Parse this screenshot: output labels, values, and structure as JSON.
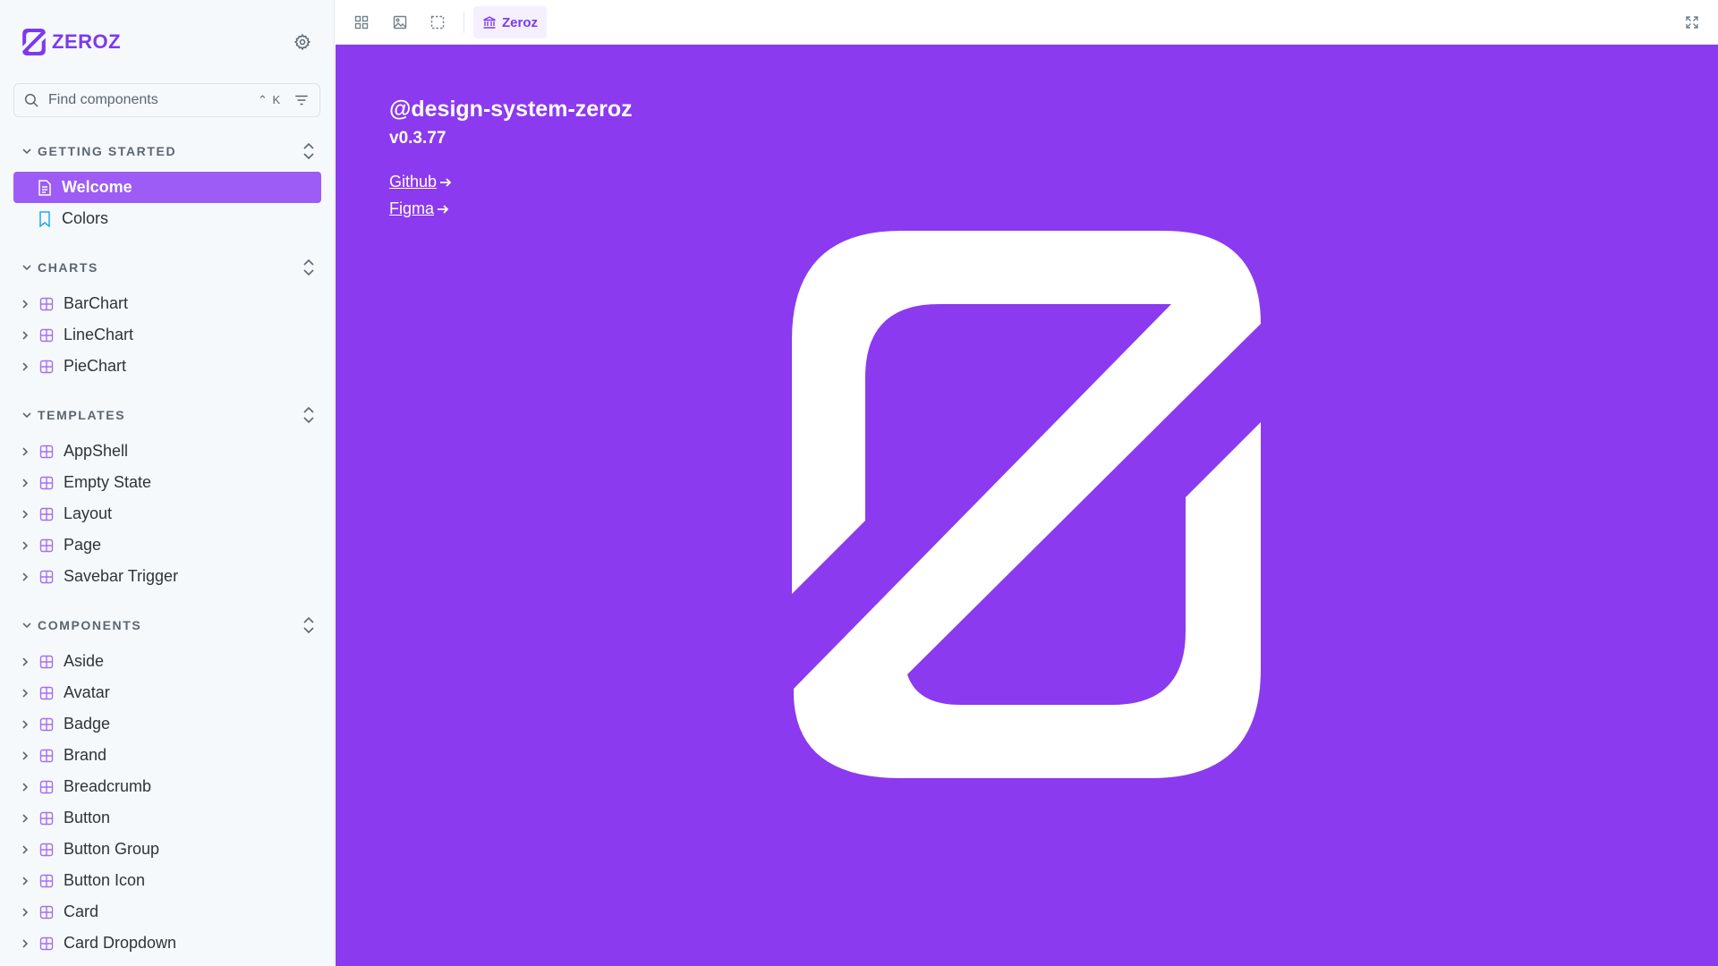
{
  "brand": {
    "name": "ZEROZ",
    "accent": "#7c3aed"
  },
  "search": {
    "placeholder": "Find components",
    "shortcut": "⌃ K"
  },
  "sections": [
    {
      "label": "GETTING STARTED",
      "items": [
        {
          "label": "Welcome",
          "icon": "document-icon",
          "active": true
        },
        {
          "label": "Colors",
          "icon": "bookmark-icon"
        }
      ]
    },
    {
      "label": "CHARTS",
      "items": [
        {
          "label": "BarChart",
          "icon": "component-icon"
        },
        {
          "label": "LineChart",
          "icon": "component-icon"
        },
        {
          "label": "PieChart",
          "icon": "component-icon"
        }
      ]
    },
    {
      "label": "TEMPLATES",
      "items": [
        {
          "label": "AppShell",
          "icon": "component-icon"
        },
        {
          "label": "Empty State",
          "icon": "component-icon"
        },
        {
          "label": "Layout",
          "icon": "component-icon"
        },
        {
          "label": "Page",
          "icon": "component-icon"
        },
        {
          "label": "Savebar Trigger",
          "icon": "component-icon"
        }
      ]
    },
    {
      "label": "COMPONENTS",
      "items": [
        {
          "label": "Aside",
          "icon": "component-icon"
        },
        {
          "label": "Avatar",
          "icon": "component-icon"
        },
        {
          "label": "Badge",
          "icon": "component-icon"
        },
        {
          "label": "Brand",
          "icon": "component-icon"
        },
        {
          "label": "Breadcrumb",
          "icon": "component-icon"
        },
        {
          "label": "Button",
          "icon": "component-icon"
        },
        {
          "label": "Button Group",
          "icon": "component-icon"
        },
        {
          "label": "Button Icon",
          "icon": "component-icon"
        },
        {
          "label": "Card",
          "icon": "component-icon"
        },
        {
          "label": "Card Dropdown",
          "icon": "component-icon"
        }
      ]
    }
  ],
  "toolbar": {
    "tab_label": "Zeroz",
    "icons": [
      "grid-icon",
      "image-icon",
      "outline-icon",
      "bank-icon",
      "fullscreen-icon"
    ]
  },
  "canvas": {
    "background": "#8b3aef",
    "package_name": "@design-system-zeroz",
    "version": "v0.3.77",
    "links": [
      {
        "label": "Github"
      },
      {
        "label": "Figma"
      }
    ]
  }
}
